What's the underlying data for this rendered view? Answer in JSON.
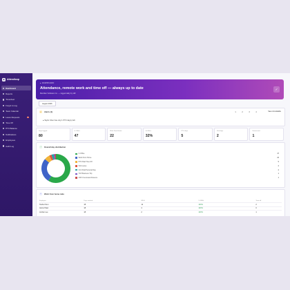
{
  "brand": {
    "name": "Attendloop"
  },
  "sidebar": {
    "items": [
      {
        "label": "Dashboard",
        "active": true
      },
      {
        "label": "Reports"
      },
      {
        "label": "Timesheet"
      },
      {
        "label": "Forgot to Log"
      },
      {
        "label": "Team Calendar"
      },
      {
        "label": "Leave Requests",
        "badge": "1"
      },
      {
        "label": "Time Off"
      },
      {
        "label": "PTO Balance"
      },
      {
        "label": "Notifications"
      },
      {
        "label": "Employees"
      },
      {
        "label": "Audit Log"
      }
    ]
  },
  "hero": {
    "kicker": "● DASHBOARD",
    "title": "Attendance, remote work and time off — always up to date",
    "subtitle": "Meridian Software Co. — logged daily by HR",
    "icon": "check-icon"
  },
  "period": {
    "label": "August 2026"
  },
  "alerts": {
    "title": "Alerts (1)",
    "pages": [
      "1",
      "2",
      "3",
      "4"
    ],
    "action": "Save Annotatable",
    "message": "● Taylor Chen has only 1 PTO day(s) left"
  },
  "stats": [
    {
      "label": "Days logged",
      "value": "80"
    },
    {
      "label": "In Office",
      "value": "47"
    },
    {
      "label": "Work From Home",
      "value": "22"
    },
    {
      "label": "In-Office",
      "value": "32%"
    },
    {
      "label": "PTO days",
      "value": "5"
    },
    {
      "label": "Sick days",
      "value": "2"
    },
    {
      "label": "Unexcused",
      "value": "1"
    }
  ],
  "distribution": {
    "title": "Overall day distribution",
    "legend": [
      {
        "label": "In Office",
        "count": "47",
        "color": "#2aa84a"
      },
      {
        "label": "Work From Home",
        "count": "22",
        "color": "#3f63c8"
      },
      {
        "label": "PTO Paid Time Off",
        "count": "5",
        "color": "#f1b43a"
      },
      {
        "label": "Sick Leave",
        "count": "2",
        "color": "#e0523f"
      },
      {
        "label": "CLS Paid Personal Day",
        "count": "2",
        "color": "#23a5a5"
      },
      {
        "label": "TCP Business Trip",
        "count": "1",
        "color": "#7a4fc4"
      },
      {
        "label": "UNX Unexcused Absence",
        "count": "1",
        "color": "#c94a4a"
      }
    ],
    "values": [
      47,
      22,
      5,
      2,
      2,
      1,
      1
    ]
  },
  "wfh": {
    "title": "Work from home ratio",
    "headers": [
      "Employee",
      "Days worked",
      "WFH",
      "% WFH",
      "Time off"
    ],
    "rows": [
      [
        "Tasha Chen",
        "18",
        "12",
        "100%",
        "2"
      ],
      [
        "Jamie Patel",
        "18",
        "4",
        "100%",
        "0"
      ],
      [
        "Jordan Lee",
        "18",
        "2",
        "100%",
        "1"
      ]
    ]
  }
}
